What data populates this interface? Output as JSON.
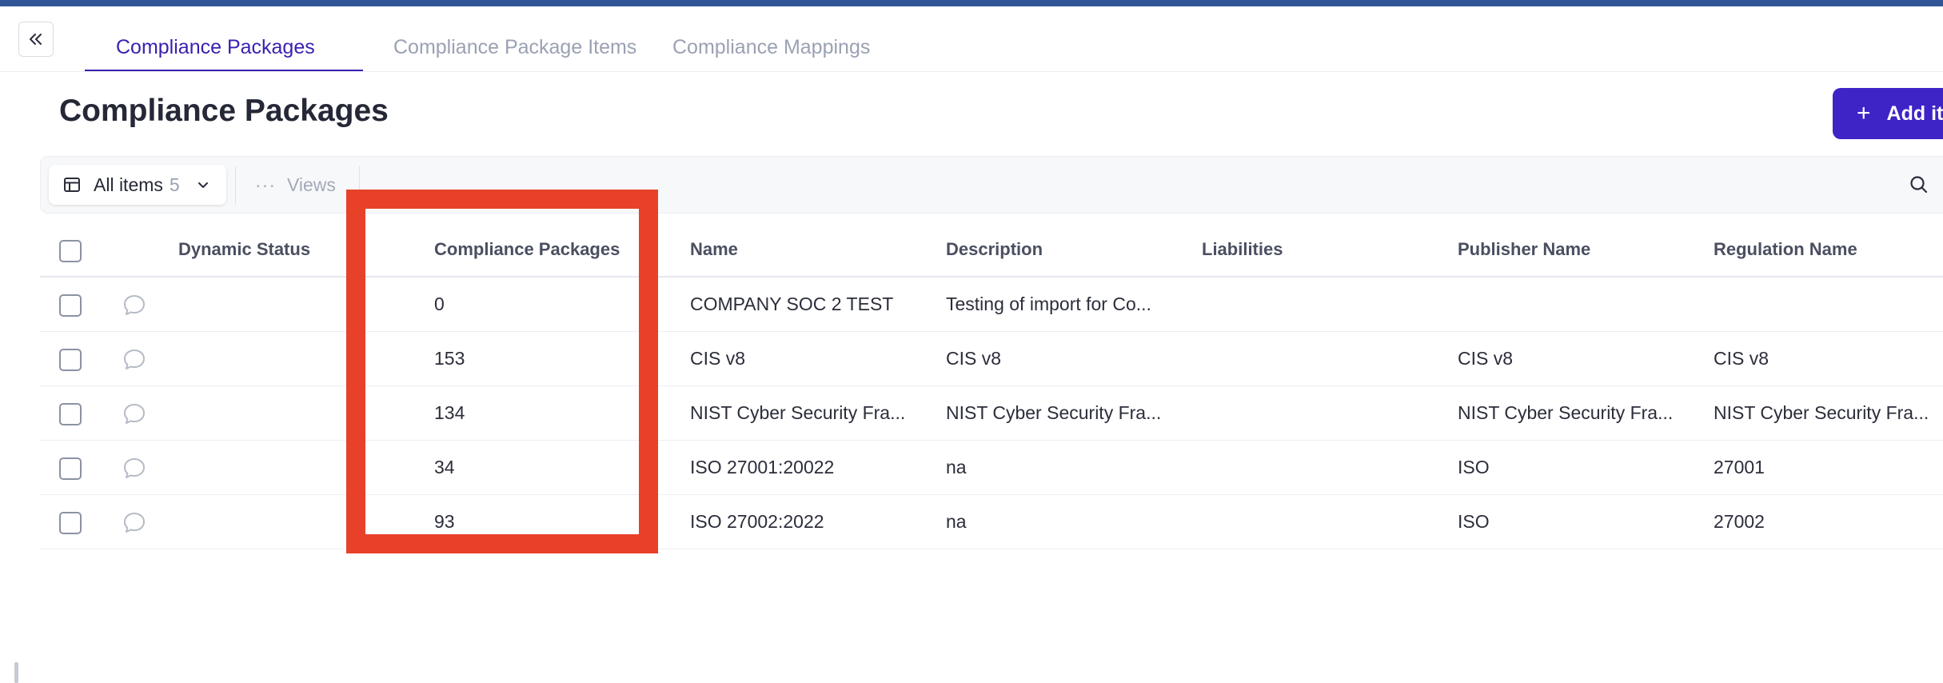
{
  "tabs": [
    {
      "label": "Compliance Packages",
      "active": true
    },
    {
      "label": "Compliance Package Items",
      "active": false
    },
    {
      "label": "Compliance Mappings",
      "active": false
    }
  ],
  "page": {
    "title": "Compliance Packages",
    "add_button_label": "Add ite"
  },
  "toolbar": {
    "view_label": "All items",
    "view_count": "5",
    "views_label": "Views"
  },
  "table": {
    "columns": [
      "Dynamic Status",
      "Compliance Packages",
      "Name",
      "Description",
      "Liabilities",
      "Publisher Name",
      "Regulation Name"
    ],
    "rows": [
      {
        "dynamic_status": "",
        "packages": "0",
        "name": "COMPANY SOC 2 TEST",
        "description": "Testing of import for Co...",
        "liabilities": "",
        "publisher": "",
        "regulation": ""
      },
      {
        "dynamic_status": "",
        "packages": "153",
        "name": "CIS v8",
        "description": "CIS v8",
        "liabilities": "",
        "publisher": "CIS v8",
        "regulation": "CIS v8"
      },
      {
        "dynamic_status": "",
        "packages": "134",
        "name": "NIST Cyber Security Fra...",
        "description": "NIST Cyber Security Fra...",
        "liabilities": "",
        "publisher": "NIST Cyber Security Fra...",
        "regulation": "NIST Cyber Security Fra..."
      },
      {
        "dynamic_status": "",
        "packages": "34",
        "name": "ISO 27001:20022",
        "description": "na",
        "liabilities": "",
        "publisher": "ISO",
        "regulation": "27001"
      },
      {
        "dynamic_status": "",
        "packages": "93",
        "name": "ISO 27002:2022",
        "description": "na",
        "liabilities": "",
        "publisher": "ISO",
        "regulation": "27002"
      }
    ]
  },
  "icons": {
    "collapse": "double-chevron-left-icon",
    "view": "table-icon",
    "dropdown": "chevron-down-icon",
    "more": "more-dots-icon",
    "search": "search-icon",
    "comment": "comment-icon",
    "add": "plus-icon"
  },
  "colors": {
    "accent": "#3e24c6",
    "active_tab": "#3b1fb0",
    "topbar": "#2f5597",
    "highlight": "#e8412a"
  }
}
